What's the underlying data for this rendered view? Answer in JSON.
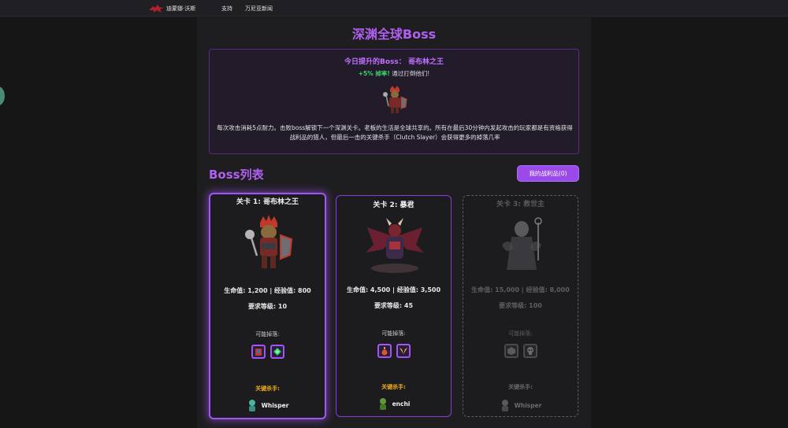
{
  "topbar": {
    "brand": "迪蒙娜·沃斯",
    "nav": [
      "支持",
      "万尼亚新闻"
    ]
  },
  "page": {
    "title": "深渊全球Boss"
  },
  "info": {
    "boost_label": "今日提升的Boss：",
    "boost_boss": "哥布林之王",
    "drop_rate": "+5% 掉率!",
    "drop_text": "通过打倒他们!",
    "description": "每次攻击消耗5点耐力。击败boss解锁下一个深渊关卡。老板的生活是全球共享的。所有在最后30分钟内发起攻击的玩家都是有资格获得战利品的猎人，但最后一击的关键杀手（Clutch Slayer）会获得更多的掉落几率"
  },
  "list": {
    "title": "Boss列表",
    "loot_button": "我的战利品(0)"
  },
  "bosses": [
    {
      "title": "关卡 1: 哥布林之王",
      "stats": "生命值: 1,200 | 经验值: 800",
      "level": "要求等级: 10",
      "drops_label": "可能掉落:",
      "slayer_label": "关键杀手:",
      "slayer_name": "Whisper",
      "state": "active"
    },
    {
      "title": "关卡 2: 暴君",
      "stats": "生命值: 4,500 | 经验值: 3,500",
      "level": "要求等级: 45",
      "drops_label": "可能掉落:",
      "slayer_label": "关键杀手:",
      "slayer_name": "enchi",
      "state": "unlocked"
    },
    {
      "title": "关卡 3: 救世主",
      "stats": "生命值: 15,000 | 经验值: 8,000",
      "level": "要求等级: 100",
      "drops_label": "可能掉落:",
      "slayer_label": "关键杀手:",
      "slayer_name": "Whisper",
      "state": "locked"
    }
  ],
  "colors": {
    "accent": "#b060f0",
    "drop_green": "#3ad46a",
    "slayer_gold": "#f2b01e"
  }
}
